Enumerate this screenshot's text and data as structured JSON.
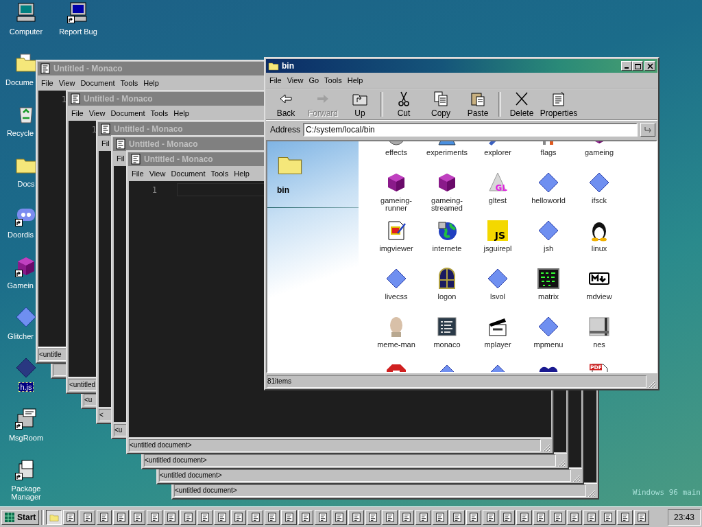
{
  "desktop": {
    "icons": [
      {
        "label": "Computer",
        "kind": "computer",
        "shortcut": false,
        "selected": false
      },
      {
        "label": "Docume",
        "kind": "docfolder",
        "shortcut": false,
        "selected": false
      },
      {
        "label": "Recycle",
        "kind": "recycle",
        "shortcut": false,
        "selected": false
      },
      {
        "label": "Docs",
        "kind": "folder",
        "shortcut": false,
        "selected": false
      },
      {
        "label": "Doordis",
        "kind": "chat",
        "shortcut": true,
        "selected": false
      },
      {
        "label": "Gamein",
        "kind": "cube",
        "shortcut": true,
        "selected": false
      },
      {
        "label": "Glitcher",
        "kind": "diamond",
        "shortcut": false,
        "selected": false
      },
      {
        "label": "h.js",
        "kind": "darkdiamond",
        "shortcut": false,
        "selected": true
      },
      {
        "label": "MsgRoom",
        "kind": "msg",
        "shortcut": true,
        "selected": false
      },
      {
        "label": "Package Manager",
        "kind": "package",
        "shortcut": true,
        "selected": false
      },
      {
        "label": "Report Bug",
        "kind": "monitor",
        "shortcut": true,
        "selected": false
      }
    ],
    "build_text": "Windows 96 main"
  },
  "editors": [
    {
      "kind": "editor",
      "title": "Untitled - Monaco",
      "menu": [
        "File",
        "View",
        "Document",
        "Tools",
        "Help"
      ],
      "line_number": "1",
      "status": "<untitle"
    },
    {
      "kind": "editor"
    },
    {
      "kind": "editor",
      "title": "Untitled - Monaco",
      "menu": [
        "File",
        "View",
        "Document",
        "Tools",
        "Help"
      ],
      "line_number": "1",
      "status": "<untitled"
    },
    {
      "kind": "editor",
      "status": "<u"
    },
    {
      "kind": "editor",
      "title": "Untitled - Monaco",
      "menu": [
        "Fil"
      ],
      "status": "<"
    },
    {
      "kind": "editor",
      "title": "Untitled - Monaco",
      "menu": [
        "Fil"
      ],
      "status": "<u"
    },
    {
      "kind": "editor",
      "title": "Untitled - Monaco",
      "menu": [
        "File",
        "View",
        "Document",
        "Tools",
        "Help"
      ],
      "line_number": "1",
      "status": "<untitled document>"
    },
    {
      "kind": "editor",
      "status": "<untitled document>"
    },
    {
      "kind": "editor",
      "status": "<untitled document>"
    },
    {
      "kind": "editor",
      "status": "<untitled document>"
    }
  ],
  "explorer": {
    "title": "bin",
    "menu": [
      "File",
      "View",
      "Go",
      "Tools",
      "Help"
    ],
    "toolbar": [
      {
        "kind": "back",
        "label": "Back",
        "disabled": false
      },
      {
        "kind": "forward",
        "label": "Forward",
        "disabled": true
      },
      {
        "kind": "up",
        "label": "Up",
        "disabled": false
      },
      {
        "kind": "separator"
      },
      {
        "kind": "cut",
        "label": "Cut",
        "disabled": false
      },
      {
        "kind": "copy",
        "label": "Copy",
        "disabled": false
      },
      {
        "kind": "paste",
        "label": "Paste",
        "disabled": false
      },
      {
        "kind": "separator"
      },
      {
        "kind": "delete",
        "label": "Delete",
        "disabled": false
      },
      {
        "kind": "properties",
        "label": "Properties",
        "disabled": false
      }
    ],
    "address_label": "Address",
    "address": "C:/system/local/bin",
    "folder_name": "bin",
    "items": [
      {
        "label": "effects",
        "kind": "gear"
      },
      {
        "label": "experiments",
        "kind": "flask"
      },
      {
        "label": "explorer",
        "kind": "pen"
      },
      {
        "label": "flags",
        "kind": "flags"
      },
      {
        "label": "gameing",
        "kind": "cube"
      },
      {
        "label": "gameing-runner",
        "kind": "cube"
      },
      {
        "label": "gameing-streamed",
        "kind": "cube"
      },
      {
        "label": "gltest",
        "kind": "cone",
        "icon_text": "GL"
      },
      {
        "label": "helloworld",
        "kind": "diamond"
      },
      {
        "label": "ifsck",
        "kind": "diamond"
      },
      {
        "label": "imgviewer",
        "kind": "paint"
      },
      {
        "label": "internete",
        "kind": "globe"
      },
      {
        "label": "jsguirepl",
        "kind": "js",
        "icon_text": "JS"
      },
      {
        "label": "jsh",
        "kind": "diamond"
      },
      {
        "label": "linux",
        "kind": "penguin"
      },
      {
        "label": "livecss",
        "kind": "diamond"
      },
      {
        "label": "logon",
        "kind": "arch"
      },
      {
        "label": "lsvol",
        "kind": "diamond"
      },
      {
        "label": "matrix",
        "kind": "matrix"
      },
      {
        "label": "mdview",
        "kind": "md"
      },
      {
        "label": "meme-man",
        "kind": "head"
      },
      {
        "label": "monaco",
        "kind": "monaco"
      },
      {
        "label": "mplayer",
        "kind": "clapper"
      },
      {
        "label": "mpmenu",
        "kind": "diamond"
      },
      {
        "label": "nes",
        "kind": "nes"
      },
      {
        "kind": "stop"
      },
      {
        "kind": "diamond"
      },
      {
        "kind": "diamond"
      },
      {
        "kind": "hearts"
      },
      {
        "kind": "pdf",
        "icon_text": "PDF"
      }
    ],
    "status": "81items"
  },
  "taskbar": {
    "start": "Start",
    "tasks": [
      {
        "kind": "folder",
        "selected": true
      },
      {
        "kind": "editor",
        "selected": false
      },
      {
        "kind": "editor",
        "selected": false
      },
      {
        "kind": "editor",
        "selected": false
      },
      {
        "kind": "editor",
        "selected": false
      },
      {
        "kind": "editor",
        "selected": false
      },
      {
        "kind": "editor",
        "selected": false
      },
      {
        "kind": "editor",
        "selected": false
      },
      {
        "kind": "editor",
        "selected": false
      },
      {
        "kind": "editor",
        "selected": false
      },
      {
        "kind": "editor",
        "selected": false
      },
      {
        "kind": "editor",
        "selected": false
      },
      {
        "kind": "editor",
        "selected": false
      },
      {
        "kind": "editor",
        "selected": false
      },
      {
        "kind": "editor",
        "selected": false
      },
      {
        "kind": "editor",
        "selected": false
      },
      {
        "kind": "editor",
        "selected": false
      },
      {
        "kind": "editor",
        "selected": false
      },
      {
        "kind": "editor",
        "selected": false
      },
      {
        "kind": "editor",
        "selected": false
      },
      {
        "kind": "editor",
        "selected": false
      },
      {
        "kind": "editor",
        "selected": false
      },
      {
        "kind": "editor",
        "selected": false
      },
      {
        "kind": "editor",
        "selected": false
      },
      {
        "kind": "editor",
        "selected": false
      },
      {
        "kind": "editor",
        "selected": false
      },
      {
        "kind": "editor",
        "selected": false
      },
      {
        "kind": "editor",
        "selected": false
      },
      {
        "kind": "editor",
        "selected": false
      },
      {
        "kind": "editor",
        "selected": false
      },
      {
        "kind": "editor",
        "selected": false
      },
      {
        "kind": "editor",
        "selected": false
      },
      {
        "kind": "editor",
        "selected": false
      },
      {
        "kind": "editor",
        "selected": false
      },
      {
        "kind": "editor",
        "selected": false
      },
      {
        "kind": "editor",
        "selected": false
      }
    ],
    "clock": "23:43"
  }
}
